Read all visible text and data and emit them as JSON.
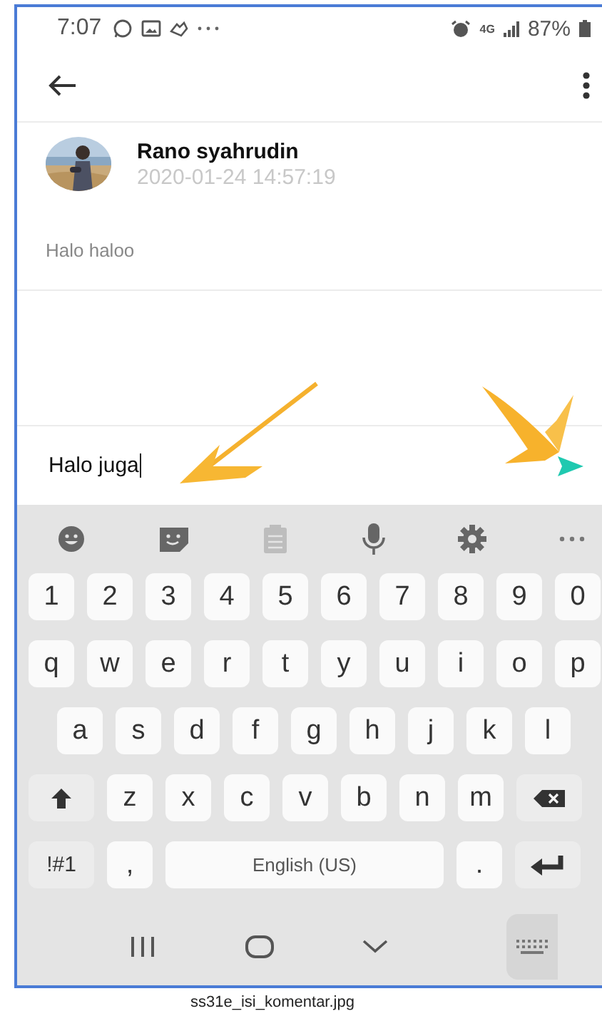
{
  "status_bar": {
    "time": "7:07",
    "network": "4G",
    "battery": "87%"
  },
  "comment": {
    "author": "Rano syahrudin",
    "timestamp": "2020-01-24 14:57:19",
    "text": "Halo haloo"
  },
  "reply_input": {
    "value": "Halo juga"
  },
  "keyboard": {
    "toolbar": [
      {
        "kind": "emoji",
        "disabled": false
      },
      {
        "kind": "sticker",
        "disabled": false
      },
      {
        "kind": "clipboard",
        "disabled": true
      },
      {
        "kind": "mic",
        "disabled": false
      },
      {
        "kind": "settings",
        "disabled": false
      },
      {
        "kind": "more",
        "disabled": false
      }
    ],
    "rows": [
      {
        "keys": [
          {
            "kind": "char",
            "label": "1"
          },
          {
            "kind": "char",
            "label": "2"
          },
          {
            "kind": "char",
            "label": "3"
          },
          {
            "kind": "char",
            "label": "4"
          },
          {
            "kind": "char",
            "label": "5"
          },
          {
            "kind": "char",
            "label": "6"
          },
          {
            "kind": "char",
            "label": "7"
          },
          {
            "kind": "char",
            "label": "8"
          },
          {
            "kind": "char",
            "label": "9"
          },
          {
            "kind": "char",
            "label": "0"
          }
        ]
      },
      {
        "keys": [
          {
            "kind": "char",
            "label": "q"
          },
          {
            "kind": "char",
            "label": "w"
          },
          {
            "kind": "char",
            "label": "e"
          },
          {
            "kind": "char",
            "label": "r"
          },
          {
            "kind": "char",
            "label": "t"
          },
          {
            "kind": "char",
            "label": "y"
          },
          {
            "kind": "char",
            "label": "u"
          },
          {
            "kind": "char",
            "label": "i"
          },
          {
            "kind": "char",
            "label": "o"
          },
          {
            "kind": "char",
            "label": "p"
          }
        ]
      },
      {
        "keys": [
          {
            "kind": "char",
            "label": "a"
          },
          {
            "kind": "char",
            "label": "s"
          },
          {
            "kind": "char",
            "label": "d"
          },
          {
            "kind": "char",
            "label": "f"
          },
          {
            "kind": "char",
            "label": "g"
          },
          {
            "kind": "char",
            "label": "h"
          },
          {
            "kind": "char",
            "label": "j"
          },
          {
            "kind": "char",
            "label": "k"
          },
          {
            "kind": "char",
            "label": "l"
          }
        ]
      },
      {
        "keys": [
          {
            "kind": "shift"
          },
          {
            "kind": "char",
            "label": "z"
          },
          {
            "kind": "char",
            "label": "x"
          },
          {
            "kind": "char",
            "label": "c"
          },
          {
            "kind": "char",
            "label": "v"
          },
          {
            "kind": "char",
            "label": "b"
          },
          {
            "kind": "char",
            "label": "n"
          },
          {
            "kind": "char",
            "label": "m"
          },
          {
            "kind": "backspace"
          }
        ]
      },
      {
        "keys": [
          {
            "kind": "symbols",
            "label": "!#1"
          },
          {
            "kind": "char",
            "label": ","
          },
          {
            "kind": "space",
            "label": "English (US)"
          },
          {
            "kind": "char",
            "label": "."
          },
          {
            "kind": "enter"
          }
        ]
      }
    ]
  },
  "caption": "ss31e_isi_komentar.jpg"
}
